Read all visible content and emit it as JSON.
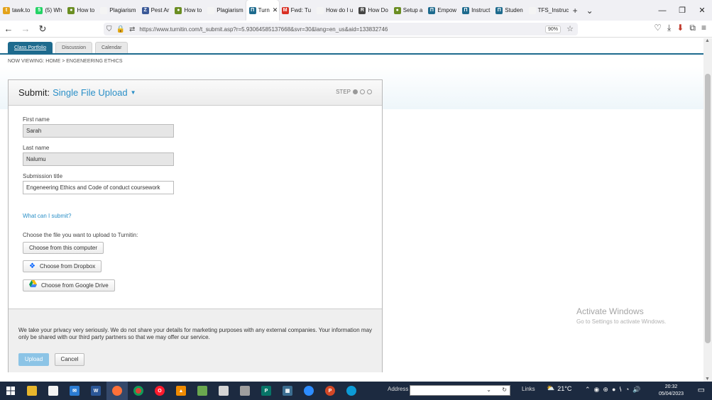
{
  "browser": {
    "tabs": [
      {
        "label": "tawk.to",
        "color": "#e3a21a",
        "glyph": "t"
      },
      {
        "label": "(5) Wh",
        "color": "#25d366",
        "glyph": "5"
      },
      {
        "label": "How to",
        "color": "#6b8e23",
        "glyph": "●"
      },
      {
        "label": "Plagiarism",
        "color": "#f4f4f4",
        "glyph": ""
      },
      {
        "label": "Pest Ar",
        "color": "#3b5998",
        "glyph": "Z"
      },
      {
        "label": "How to",
        "color": "#6b8e23",
        "glyph": "●"
      },
      {
        "label": "Plagiarism",
        "color": "#f4f4f4",
        "glyph": ""
      },
      {
        "label": "Turn",
        "color": "#1e6b8e",
        "glyph": "П",
        "active": true
      },
      {
        "label": "Fwd: Tu",
        "color": "#d93025",
        "glyph": "M"
      },
      {
        "label": "How do I u",
        "color": "#f4f4f4",
        "glyph": ""
      },
      {
        "label": "How Do",
        "color": "#444",
        "glyph": "R"
      },
      {
        "label": "Setup a",
        "color": "#6b8e23",
        "glyph": "●"
      },
      {
        "label": "Empow",
        "color": "#1e6b8e",
        "glyph": "П"
      },
      {
        "label": "Instruct",
        "color": "#1e6b8e",
        "glyph": "П"
      },
      {
        "label": "Studen",
        "color": "#1e6b8e",
        "glyph": "П"
      },
      {
        "label": "TFS_Instruct",
        "color": "#f4f4f4",
        "glyph": ""
      }
    ],
    "url": "https://www.turnitin.com/t_submit.asp?r=5.93064585137668&svr=30&lang=en_us&aid=133832746",
    "zoom": "90%"
  },
  "turnitin": {
    "tabs": [
      "Class Portfolio",
      "Discussion",
      "Calendar"
    ],
    "now_viewing": "NOW VIEWING: HOME > ENGENEERING ETHICS",
    "submit_label": "Submit:",
    "submit_mode": "Single File Upload",
    "step_label": "STEP",
    "first_name_label": "First name",
    "first_name_value": "Sarah",
    "last_name_label": "Last name",
    "last_name_value": "Nalumu",
    "title_label": "Submission title",
    "title_value": "Engeneering Ethics and Code of conduct coursework",
    "what_link": "What can I submit?",
    "choose_label": "Choose the file you want to upload to Turnitin:",
    "btn_computer": "Choose from this computer",
    "btn_dropbox": "Choose from Dropbox",
    "btn_gdrive": "Choose from Google Drive",
    "privacy": "We take your privacy very seriously. We do not share your details for marketing purposes with any external companies. Your information may only be shared with our third party partners so that we may offer our service.",
    "upload_btn": "Upload",
    "cancel_btn": "Cancel"
  },
  "watermark": {
    "line1": "Activate Windows",
    "line2": "Go to Settings to activate Windows."
  },
  "taskbar": {
    "address_label": "Address",
    "links_label": "Links",
    "temperature": "21°C",
    "time": "20:32",
    "date": "05/04/2023"
  }
}
